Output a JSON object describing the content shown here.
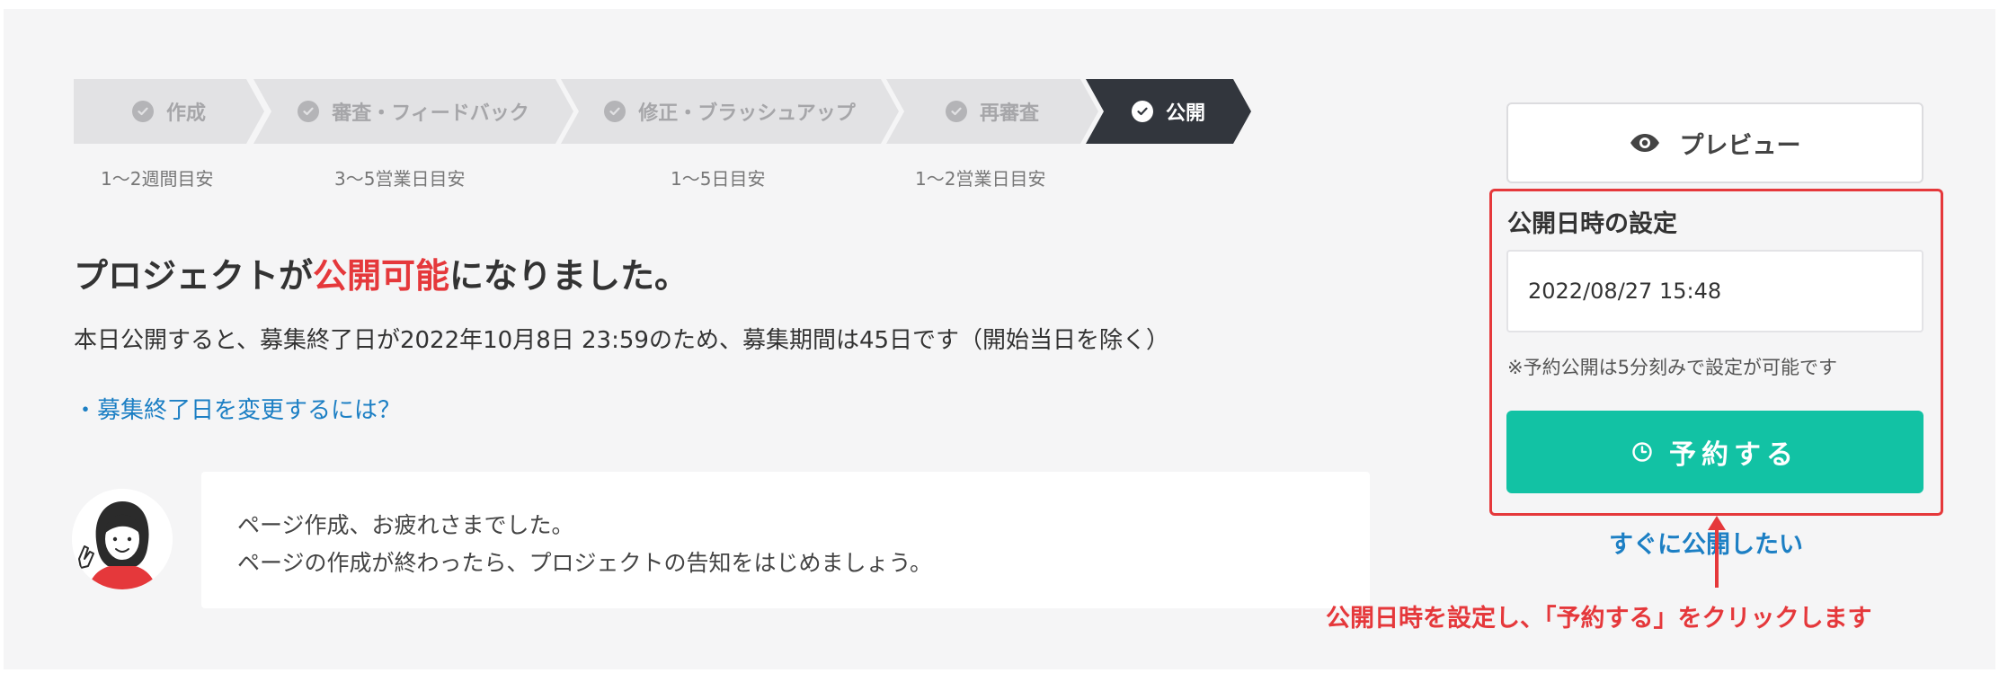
{
  "stepper": {
    "steps": [
      {
        "label": "作成",
        "sub": "1〜2週間目安",
        "state": "done"
      },
      {
        "label": "審査・フィードバック",
        "sub": "3〜5営業日目安",
        "state": "done"
      },
      {
        "label": "修正・ブラッシュアップ",
        "sub": "1〜5日目安",
        "state": "done"
      },
      {
        "label": "再審査",
        "sub": "1〜2営業日目安",
        "state": "done"
      },
      {
        "label": "公開",
        "sub": "",
        "state": "current"
      }
    ]
  },
  "main": {
    "headline_prefix": "プロジェクトが",
    "headline_highlight": "公開可能",
    "headline_suffix": "になりました。",
    "description": "本日公開すると、募集終了日が2022年10月8日 23:59のため、募集期間は45日です（開始当日を除く）",
    "faq_link": "・募集終了日を変更するには？"
  },
  "message": {
    "line1": "ページ作成、お疲れさまでした。",
    "line2": "ページの作成が終わったら、プロジェクトの告知をはじめましょう。"
  },
  "sidebar": {
    "preview_label": "プレビュー",
    "schedule_title": "公開日時の設定",
    "schedule_value": "2022/08/27 15:48",
    "schedule_note": "※予約公開は5分刻みで設定が可能です",
    "reserve_label": "予約する",
    "publish_now_label": "すぐに公開したい"
  },
  "annotation": {
    "text": "公開日時を設定し、「予約する」をクリックします"
  },
  "colors": {
    "accent_red": "#e5383b",
    "reserve_green": "#12c2a4",
    "link_blue": "#1c7fc4",
    "step_active": "#32363d",
    "step_inactive": "#e2e2e4"
  },
  "icons": {
    "step_check": "check-circle-icon",
    "preview": "eye-icon",
    "reserve": "clock-icon",
    "annotation_arrow": "arrow-up-icon"
  }
}
